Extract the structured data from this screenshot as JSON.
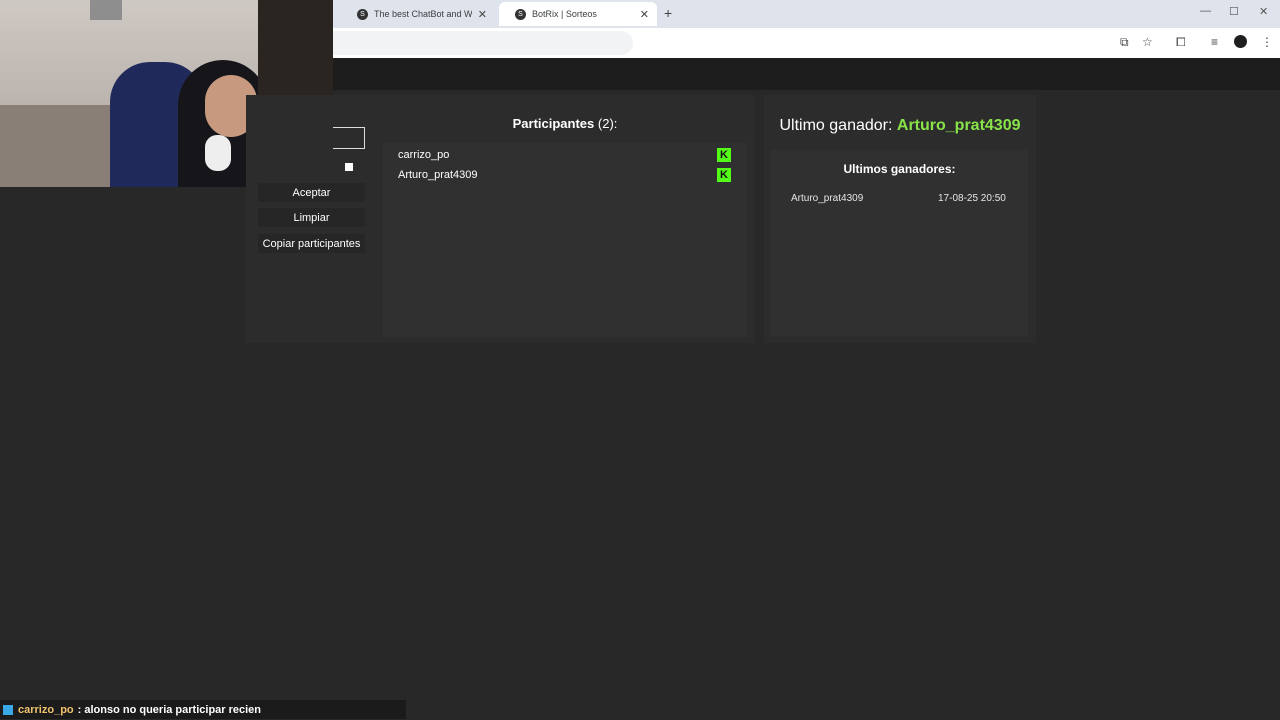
{
  "browser": {
    "tabs": [
      {
        "favicon": "S",
        "title": "The best ChatBot and Widgets",
        "close": "✕"
      },
      {
        "favicon": "S",
        "title": "BotRix | Sorteos",
        "close": "✕"
      }
    ],
    "new_tab": "+",
    "window_controls": {
      "minimize": "—",
      "maximize": "☐",
      "close": "✕"
    },
    "toolbar_icons": {
      "translate": "⧉",
      "star": "☆",
      "extensions": "⧠",
      "media": "≡",
      "menu": "⋮"
    }
  },
  "controls": {
    "accept": "Aceptar",
    "clear": "Limpiar",
    "copy_participants": "Copiar participantes"
  },
  "participants": {
    "label": "Participantes",
    "count": "(2):",
    "items": [
      {
        "name": "carrizo_po",
        "platform_icon": "K"
      },
      {
        "name": "Arturo_prat4309",
        "platform_icon": "K"
      }
    ]
  },
  "winner": {
    "label": "Ultimo ganador:",
    "name": "Arturo_prat4309"
  },
  "winners_history": {
    "title": "Ultimos ganadores:",
    "items": [
      {
        "name": "Arturo_prat4309",
        "date": "17-08-25 20:50"
      }
    ]
  },
  "chat": {
    "user": "carrizo_po",
    "message": ": alonso no queria participar recien"
  },
  "colors": {
    "background": "#282828",
    "panel": "#2c2c2c",
    "winner_green": "#88e349",
    "kick_green": "#53fc18"
  }
}
